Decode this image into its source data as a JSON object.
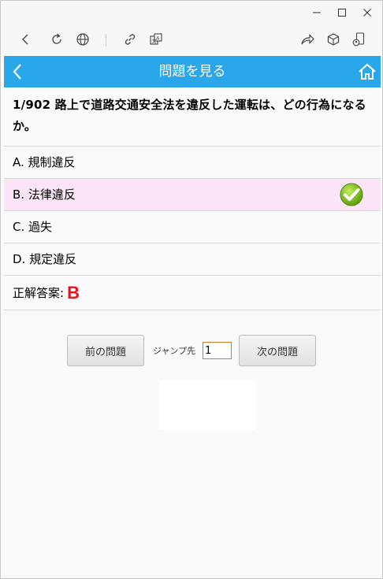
{
  "window": {
    "controls": [
      "minimize",
      "maximize",
      "close"
    ]
  },
  "toolbar": {
    "buttons": [
      "back-icon",
      "refresh-icon",
      "globe-icon",
      "link-icon",
      "translate-icon",
      "share-icon",
      "package-icon",
      "profile-icon"
    ]
  },
  "appbar": {
    "title": "問題を見る",
    "back_icon": "chevron-left-icon",
    "home_icon": "home-icon"
  },
  "question": {
    "text": "1/902 路上で道路交通安全法を違反した運転は、どの行為になるか。"
  },
  "options": [
    {
      "label": "A. 規制違反",
      "correct": false
    },
    {
      "label": "B. 法律違反",
      "correct": true
    },
    {
      "label": "C. 過失",
      "correct": false
    },
    {
      "label": "D. 規定違反",
      "correct": false
    }
  ],
  "answer": {
    "label": "正解答案:",
    "value": "B"
  },
  "nav": {
    "prev_label": "前の問題",
    "jump_label": "ジャンプ先",
    "jump_value": "1",
    "next_label": "次の問題"
  },
  "colors": {
    "appbar": "#29a7ea",
    "correct_row": "#fae4f6",
    "answer_letter": "#e8121a",
    "check": "#7fc41a"
  }
}
